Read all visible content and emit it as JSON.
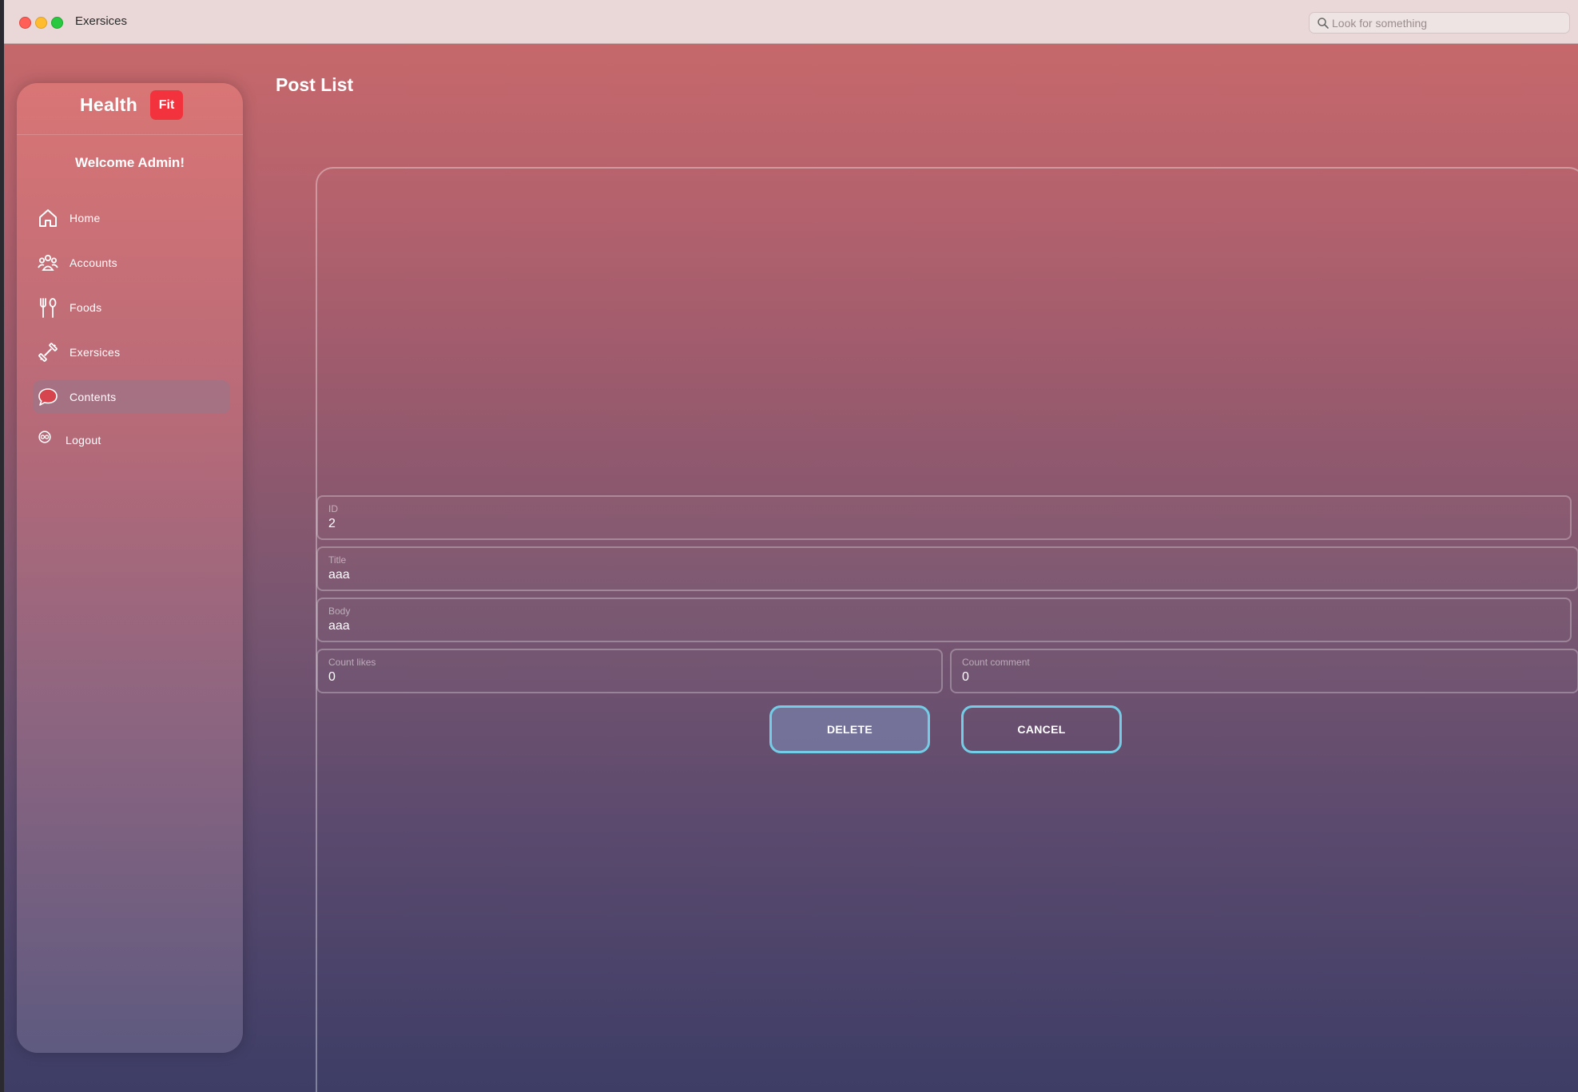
{
  "window": {
    "title": "Exersices"
  },
  "search": {
    "placeholder": "Look for something"
  },
  "sidebar": {
    "brand_name": "Health",
    "brand_badge": "Fit",
    "welcome": "Welcome Admin!",
    "items": [
      {
        "label": "Home",
        "icon": "home-icon"
      },
      {
        "label": "Accounts",
        "icon": "accounts-icon"
      },
      {
        "label": "Foods",
        "icon": "fork-knife-icon"
      },
      {
        "label": "Exersices",
        "icon": "dumbbell-icon"
      },
      {
        "label": "Contents",
        "icon": "chat-bubble-icon",
        "active": true
      },
      {
        "label": "Logout",
        "icon": "logout-icon"
      }
    ]
  },
  "main": {
    "title": "Post List",
    "fields": {
      "id": {
        "label": "ID",
        "value": "2"
      },
      "title": {
        "label": "Title",
        "value": "aaa"
      },
      "body": {
        "label": "Body",
        "value": "aaa"
      },
      "count_likes": {
        "label": "Count likes",
        "value": "0"
      },
      "count_comment": {
        "label": "Count comment",
        "value": "0"
      }
    },
    "delete_label": "DELETE",
    "cancel_label": "CANCEL"
  },
  "colors": {
    "accent": "#74cde6",
    "brand_badge": "#f2323c",
    "gradient_top": "#cb6a6a",
    "gradient_bottom": "#3d3d66"
  }
}
